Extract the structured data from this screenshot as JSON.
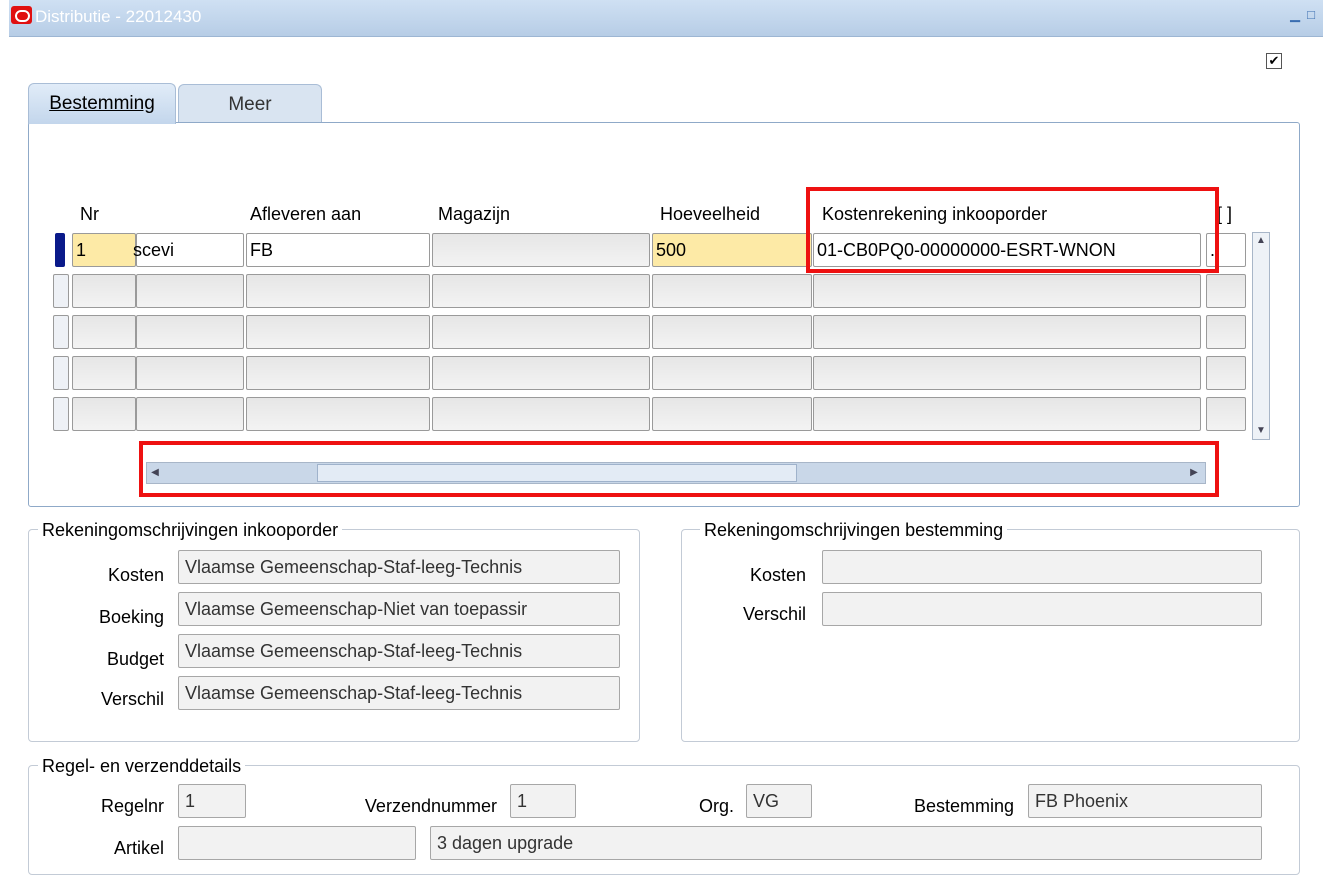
{
  "window": {
    "title": "Distributie - 22012430",
    "checkbox_checked": "✔"
  },
  "tabs": [
    {
      "label": "Bestemming",
      "active": true
    },
    {
      "label": "Meer",
      "active": false
    }
  ],
  "grid": {
    "headers": {
      "nr": "Nr",
      "afleveren": "Afleveren aan",
      "magazijn": "Magazijn",
      "hoeveelheid": "Hoeveelheid",
      "kostenrekening": "Kostenrekening inkooporder",
      "extra": "[ ]"
    },
    "rows": [
      {
        "nr": "1",
        "type": "scevi",
        "afleveren": "FB",
        "magazijn": "",
        "hoeveelheid": "500",
        "kostenrekening": "01-CB0PQ0-00000000-ESRT-WNON",
        "extra": "."
      },
      {
        "nr": "",
        "type": "",
        "afleveren": "",
        "magazijn": "",
        "hoeveelheid": "",
        "kostenrekening": "",
        "extra": ""
      },
      {
        "nr": "",
        "type": "",
        "afleveren": "",
        "magazijn": "",
        "hoeveelheid": "",
        "kostenrekening": "",
        "extra": ""
      },
      {
        "nr": "",
        "type": "",
        "afleveren": "",
        "magazijn": "",
        "hoeveelheid": "",
        "kostenrekening": "",
        "extra": ""
      },
      {
        "nr": "",
        "type": "",
        "afleveren": "",
        "magazijn": "",
        "hoeveelheid": "",
        "kostenrekening": "",
        "extra": ""
      }
    ]
  },
  "rek_inkooporder": {
    "title": "Rekeningomschrijvingen inkooporder",
    "kosten_label": "Kosten",
    "kosten_value": "Vlaamse Gemeenschap-Staf-leeg-Technis",
    "boeking_label": "Boeking",
    "boeking_value": "Vlaamse Gemeenschap-Niet van toepassir",
    "budget_label": "Budget",
    "budget_value": "Vlaamse Gemeenschap-Staf-leeg-Technis",
    "verschil_label": "Verschil",
    "verschil_value": "Vlaamse Gemeenschap-Staf-leeg-Technis"
  },
  "rek_bestemming": {
    "title": "Rekeningomschrijvingen bestemming",
    "kosten_label": "Kosten",
    "kosten_value": "",
    "verschil_label": "Verschil",
    "verschil_value": ""
  },
  "regel": {
    "title": "Regel- en verzenddetails",
    "regelnr_label": "Regelnr",
    "regelnr_value": "1",
    "verzend_label": "Verzendnummer",
    "verzend_value": "1",
    "org_label": "Org.",
    "org_value": "VG",
    "bestemming_label": "Bestemming",
    "bestemming_value": "FB Phoenix",
    "artikel_label": "Artikel",
    "artikel_value": "",
    "artikel_desc": "3 dagen upgrade"
  },
  "colors": {
    "highlight_box": "#ee1111",
    "required_field": "#fdeaa6",
    "current_row_marker": "#0a1a8a"
  }
}
